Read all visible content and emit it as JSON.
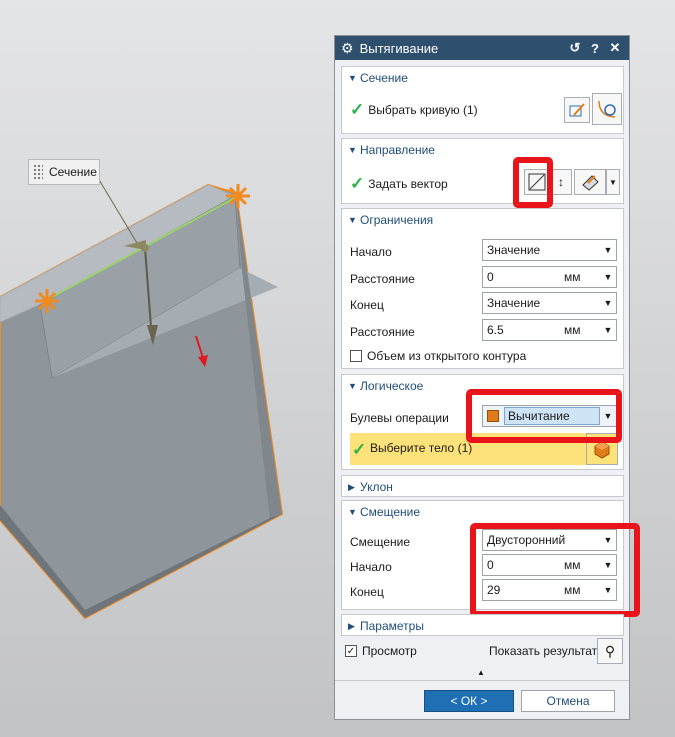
{
  "viewport": {
    "section_tag": "Сечение"
  },
  "dialog": {
    "title": "Вытягивание",
    "sections": {
      "section": {
        "title": "Сечение",
        "select_curve": "Выбрать кривую (1)"
      },
      "direction": {
        "title": "Направление",
        "set_vector": "Задать вектор"
      },
      "limits": {
        "title": "Ограничения",
        "start_label": "Начало",
        "start_value": "Значение",
        "distance1_label": "Расстояние",
        "distance1_value": "0",
        "distance1_unit": "мм",
        "end_label": "Конец",
        "end_value": "Значение",
        "distance2_label": "Расстояние",
        "distance2_value": "6.5",
        "distance2_unit": "мм",
        "open_profile": "Объем из открытого контура"
      },
      "boolean": {
        "title": "Логическое",
        "op_label": "Булевы операции",
        "op_value": "Вычитание",
        "select_body": "Выберите тело (1)"
      },
      "draft": {
        "title": "Уклон"
      },
      "offset": {
        "title": "Смещение",
        "offset_label": "Смещение",
        "offset_value": "Двусторонний",
        "start_label": "Начало",
        "start_value": "0",
        "start_unit": "мм",
        "end_label": "Конец",
        "end_value": "29",
        "end_unit": "мм"
      },
      "params": {
        "title": "Параметры"
      }
    },
    "preview_label": "Просмотр",
    "show_result_label": "Показать результат",
    "ok_label": "< ОК >",
    "cancel_label": "Отмена"
  },
  "colors": {
    "title_bar": "#2f4f6f",
    "section_header": "#1f4e7a",
    "highlight": "#e8141a",
    "selected_row": "#fde27a",
    "ok_button": "#1e6fb4"
  }
}
